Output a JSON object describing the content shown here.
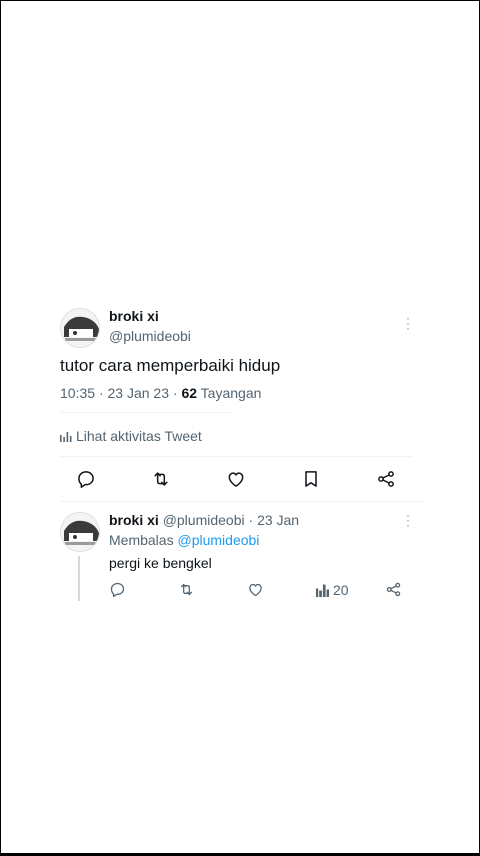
{
  "main_tweet": {
    "author_name": "broki xi",
    "author_handle": "@plumideobi",
    "text": "tutor cara memperbaiki hidup",
    "time": "10:35",
    "sep1": "·",
    "date": "23 Jan 23",
    "sep2": "·",
    "views_count": "62",
    "views_label": "Tayangan",
    "activity_label": "Lihat aktivitas Tweet",
    "icons": [
      "more-icon",
      "reply-icon",
      "retweet-icon",
      "like-icon",
      "bookmark-icon",
      "share-icon",
      "analytics-icon"
    ]
  },
  "reply_tweet": {
    "author_name": "broki xi",
    "author_handle": "@plumideobi",
    "sep": "·",
    "date": "23 Jan",
    "replying_prefix": "Membalas",
    "replying_to": "@plumideobi",
    "text": "pergi ke bengkel",
    "views_count": "20"
  },
  "colors": {
    "link": "#1d9bf0",
    "text": "#0f1419",
    "secondary": "#536471",
    "border": "#eff3f4"
  }
}
